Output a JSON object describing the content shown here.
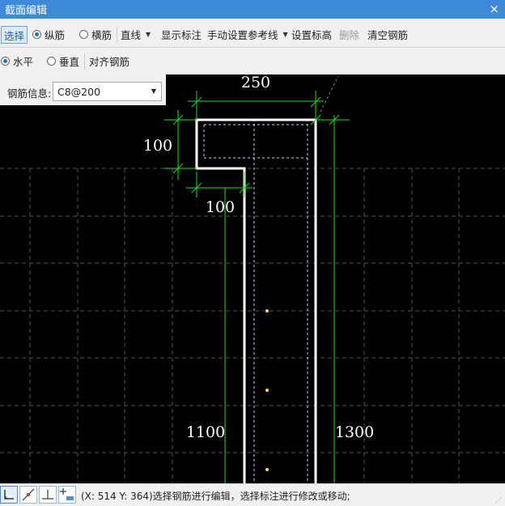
{
  "window": {
    "title": "截面编辑",
    "close_glyph": "×"
  },
  "toolbar": {
    "select": "选择",
    "longitudinal": "纵筋",
    "transverse": "横筋",
    "line": "直线",
    "show_dim": "显示标注",
    "manual_ref": "手动设置参考线",
    "set_elev": "设置标高",
    "delete": "删除",
    "clear": "清空钢筋",
    "horizontal": "水平",
    "vertical": "垂直",
    "align": "对齐钢筋",
    "selected_type": "纵筋",
    "selected_orientation": "水平"
  },
  "info": {
    "label": "钢筋信息:",
    "value": "C8@200"
  },
  "dims": {
    "top": "250",
    "left": "100",
    "inner": "100",
    "left_len": "1100",
    "right_len": "1300"
  },
  "status": {
    "text": "(X: 514 Y: 364)选择钢筋进行编辑，选择标注进行修改或移动;"
  },
  "colors": {
    "title_bar": "#3d8bd8",
    "canvas_bg": "#000000",
    "dim_line": "#22dd22",
    "rebar": "#ffffff",
    "node": "#ffdd33"
  }
}
